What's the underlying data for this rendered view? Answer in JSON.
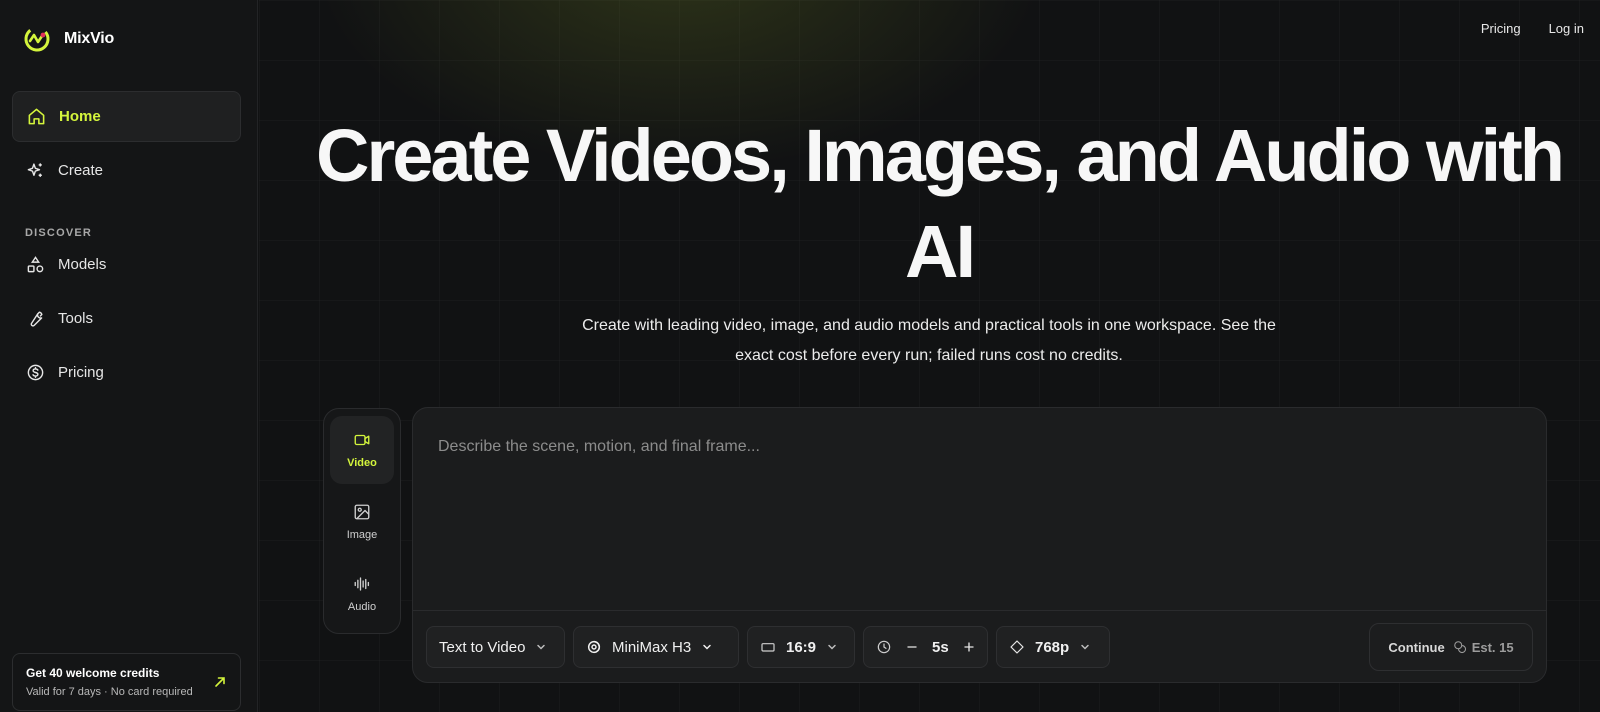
{
  "brand": {
    "name": "MixVio",
    "accent": "#d4f53c"
  },
  "sidebar": {
    "items": [
      {
        "label": "Home",
        "icon": "home-icon",
        "active": true
      },
      {
        "label": "Create",
        "icon": "sparkles-icon",
        "active": false
      }
    ],
    "section_label": "DISCOVER",
    "discover_items": [
      {
        "label": "Models",
        "icon": "shapes-icon"
      },
      {
        "label": "Tools",
        "icon": "wrench-icon"
      },
      {
        "label": "Pricing",
        "icon": "dollar-circle-icon"
      }
    ],
    "promo": {
      "title": "Get 40 welcome credits",
      "subtitle": "Valid for 7 days · No card required"
    }
  },
  "topnav": {
    "pricing": "Pricing",
    "login": "Log in"
  },
  "hero": {
    "title": "Create Videos, Images, and Audio with AI",
    "subtitle": "Create with leading video, image, and audio models and practical tools in one workspace. See the exact cost before every run; failed runs cost no credits."
  },
  "modes": [
    {
      "label": "Video",
      "icon": "video-icon",
      "active": true
    },
    {
      "label": "Image",
      "icon": "image-icon",
      "active": false
    },
    {
      "label": "Audio",
      "icon": "waveform-icon",
      "active": false
    }
  ],
  "prompt": {
    "placeholder": "Describe the scene, motion, and final frame...",
    "value": ""
  },
  "controls": {
    "mode": "Text to Video",
    "model": "MiniMax H3",
    "aspect": "16:9",
    "duration": "5s",
    "resolution": "768p",
    "continue_label": "Continue",
    "estimate": "Est. 15"
  }
}
